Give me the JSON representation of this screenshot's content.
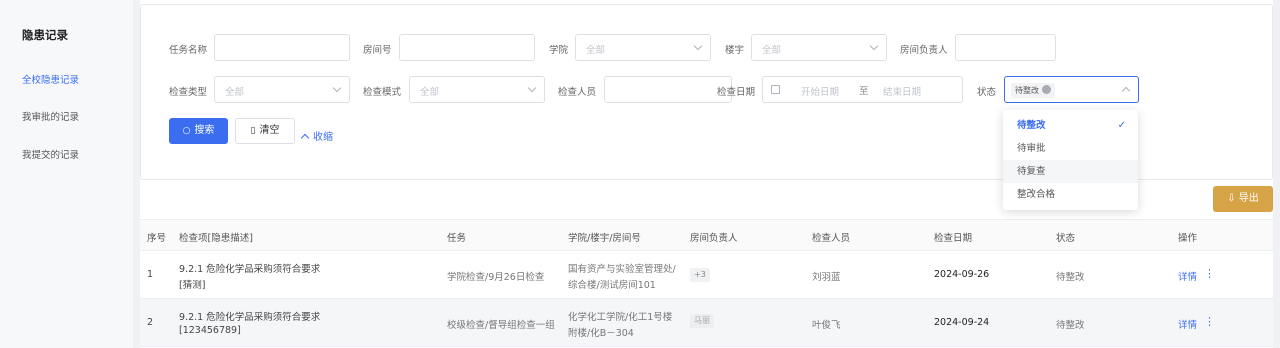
{
  "sidebar": {
    "title": "隐患记录",
    "items": [
      {
        "label": "全校隐患记录",
        "active": true
      },
      {
        "label": "我审批的记录",
        "active": false
      },
      {
        "label": "我提交的记录",
        "active": false
      }
    ]
  },
  "filters": {
    "task_name": {
      "label": "任务名称",
      "value": ""
    },
    "room_no": {
      "label": "房间号",
      "value": ""
    },
    "college": {
      "label": "学院",
      "placeholder": "全部"
    },
    "building": {
      "label": "楼宇",
      "placeholder": "全部"
    },
    "room_owner": {
      "label": "房间负责人",
      "value": ""
    },
    "check_type": {
      "label": "检查类型",
      "placeholder": "全部"
    },
    "check_mode": {
      "label": "检查模式",
      "placeholder": "全部"
    },
    "inspector": {
      "label": "检查人员",
      "value": ""
    },
    "check_date": {
      "label": "检查日期",
      "start_placeholder": "开始日期",
      "separator": "至",
      "end_placeholder": "结束日期"
    },
    "status": {
      "label": "状态",
      "selected_tag": "待整改"
    }
  },
  "buttons": {
    "search": "搜索",
    "clear": "清空",
    "collapse": "收缩",
    "export": "导出"
  },
  "status_dropdown": {
    "options": [
      {
        "label": "待整改",
        "selected": true
      },
      {
        "label": "待审批",
        "selected": false
      },
      {
        "label": "待复查",
        "selected": false
      },
      {
        "label": "整改合格",
        "selected": false
      }
    ]
  },
  "table": {
    "headers": [
      "序号",
      "检查项[隐患描述]",
      "任务",
      "学院/楼宇/房间号",
      "房间负责人",
      "检查人员",
      "检查日期",
      "状态",
      "操作"
    ],
    "rows": [
      {
        "index": "1",
        "item_line1": "9.2.1 危险化学品采购须符合要求",
        "item_line2": "[猜测]",
        "task": "学院检查/9月26日检查",
        "location_line1": "国有资产与实验室管理处/",
        "location_line2": "综合楼/测试房间101",
        "owner": "+3",
        "inspector": "刘羽蓝",
        "date": "2024-09-26",
        "status": "待整改",
        "action": "详情"
      },
      {
        "index": "2",
        "item_line1": "9.2.1 危险化学品采购须符合要求",
        "item_line2": "[123456789]",
        "task": "校级检查/督导组检查一组",
        "location_line1": "化学化工学院/化工1号楼",
        "location_line2": "附楼/化B－304",
        "owner": "马丽",
        "inspector": "叶俊飞",
        "date": "2024-09-24",
        "status": "待整改",
        "action": "详情"
      }
    ]
  }
}
